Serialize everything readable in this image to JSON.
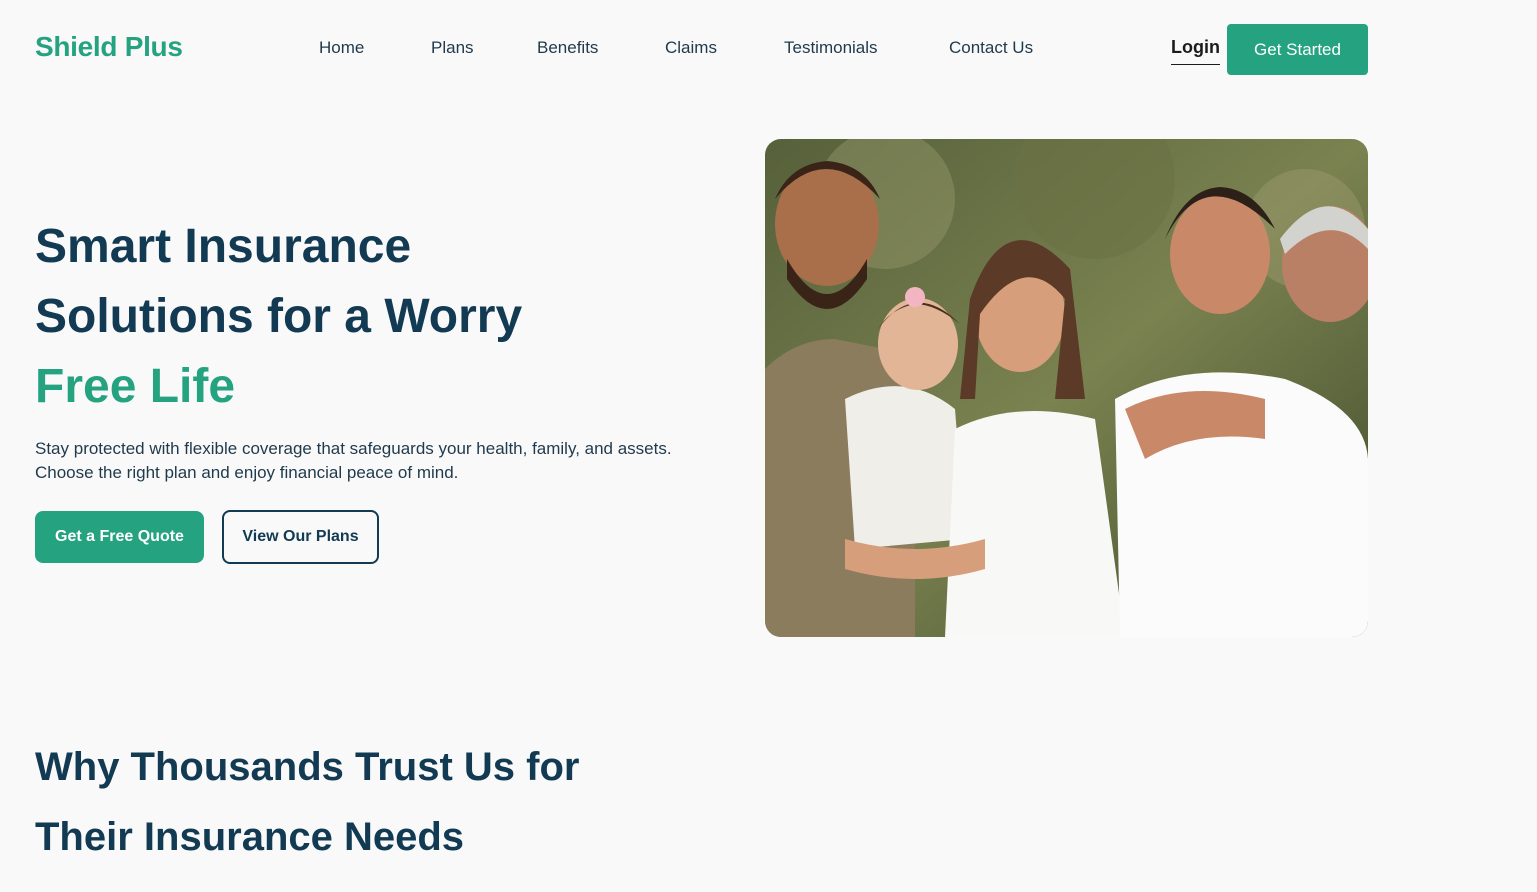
{
  "brand": {
    "name": "Shield Plus",
    "color": "#25a381",
    "dark": "#123a52"
  },
  "nav": {
    "items": [
      "Home",
      "Plans",
      "Benefits",
      "Claims",
      "Testimonials",
      "Contact Us"
    ],
    "login": "Login",
    "cta": "Get Started"
  },
  "hero": {
    "title_line1": "Smart Insurance",
    "title_line2": "Solutions for a Worry",
    "title_accent": "Free Life",
    "subtitle": "Stay protected with flexible coverage that safeguards your health, family, and assets. Choose the right plan and enjoy financial peace of mind.",
    "primary_button": "Get a Free Quote",
    "secondary_button": "View Our Plans",
    "image": "family-photo"
  },
  "section": {
    "title_line1": "Why Thousands Trust Us for",
    "title_line2": "Their Insurance Needs"
  }
}
